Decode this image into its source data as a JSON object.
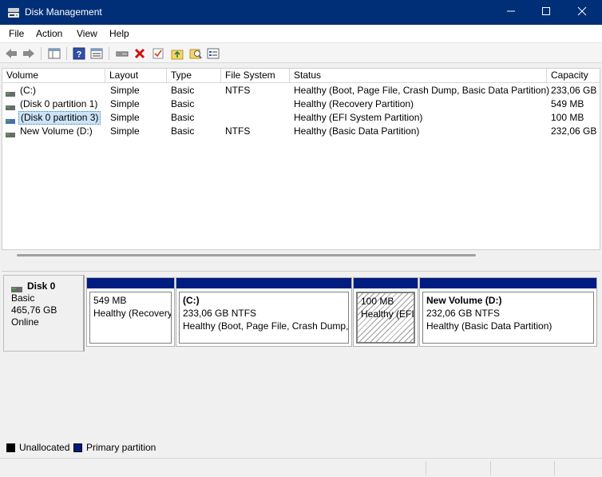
{
  "window": {
    "title": "Disk Management"
  },
  "menu": [
    {
      "label": "File"
    },
    {
      "label": "Action"
    },
    {
      "label": "View"
    },
    {
      "label": "Help"
    }
  ],
  "toolbar": {
    "icons": [
      "back-icon",
      "forward-icon",
      "console-tree-icon",
      "help-icon",
      "properties-icon",
      "connect-drive-icon",
      "delete-icon",
      "check-icon",
      "folder-up-icon",
      "search-icon",
      "settings-icon"
    ]
  },
  "volume_list": {
    "columns": [
      "Volume",
      "Layout",
      "Type",
      "File System",
      "Status",
      "Capacity"
    ],
    "rows": [
      {
        "volume": "(C:)",
        "layout": "Simple",
        "type": "Basic",
        "fs": "NTFS",
        "status": "Healthy (Boot, Page File, Crash Dump, Basic Data Partition)",
        "capacity": "233,06 GB"
      },
      {
        "volume": "(Disk 0 partition 1)",
        "layout": "Simple",
        "type": "Basic",
        "fs": "",
        "status": "Healthy (Recovery Partition)",
        "capacity": "549 MB"
      },
      {
        "volume": "(Disk 0 partition 3)",
        "layout": "Simple",
        "type": "Basic",
        "fs": "",
        "status": "Healthy (EFI System Partition)",
        "capacity": "100 MB"
      },
      {
        "volume": "New Volume (D:)",
        "layout": "Simple",
        "type": "Basic",
        "fs": "NTFS",
        "status": "Healthy (Basic Data Partition)",
        "capacity": "232,06 GB"
      }
    ]
  },
  "disk": {
    "name": "Disk 0",
    "type": "Basic",
    "size": "465,76 GB",
    "state": "Online",
    "partitions": [
      {
        "name": "",
        "size": "549 MB",
        "status": "Healthy (Recovery"
      },
      {
        "name": "(C:)",
        "size": "233,06 GB NTFS",
        "status": "Healthy (Boot, Page File, Crash Dump, B"
      },
      {
        "name": "",
        "size": "100 MB",
        "status": "Healthy (EFI"
      },
      {
        "name": "New Volume  (D:)",
        "size": "232,06 GB NTFS",
        "status": "Healthy (Basic Data Partition)"
      }
    ]
  },
  "legend": [
    {
      "label": "Unallocated",
      "color": "#000000"
    },
    {
      "label": "Primary partition",
      "color": "#001c80"
    }
  ],
  "colors": {
    "titlebar": "#002f78",
    "primary": "#001c80",
    "selection": "#cce4f7"
  }
}
